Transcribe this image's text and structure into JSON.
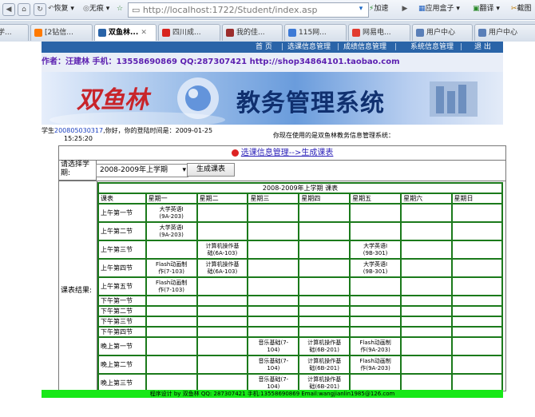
{
  "browser": {
    "back_label": "恢复",
    "noimg_label": "无痕",
    "url": "http://localhost:1722/Student/index.asp",
    "accelerate_label": "加速",
    "app_box_label": "应用盒子",
    "translate_label": "翻译",
    "screenshot_label": "截图",
    "tabs": [
      "学...",
      "[2钻信...",
      "双鱼林...",
      "四川成...",
      "我的佳...",
      "115网...",
      "网易电...",
      "用户中心",
      "用户中心"
    ]
  },
  "site": {
    "nav": [
      "首 页",
      "选课信息管理",
      "成绩信息管理",
      "系统信息管理",
      "退 出"
    ],
    "author": "作者：汪建林  手机：13558690869 QQ:287307421 http://shop34864101.taobao.com",
    "banner_left": "双鱼林",
    "banner_right": "教务管理系统",
    "student_prefix": "学生",
    "student_id": "200805030317",
    "login_text": ",你好，你的登陆时间是：2009-01-25",
    "login_time": "15:25:20",
    "using_text": "你现在使用的是双鱼林教务信息管理系统：",
    "breadcrumb": "选课信息管理-->生成课表",
    "term_label": "请选择学期:",
    "term_value": "2008-2009年上学期",
    "generate_button": "生成课表",
    "result_label": "课表结果:",
    "footer": "程序设计 by 双鱼林  QQ: 287307421 手机:13558690869 Email:wangjianlin1985@126.com"
  },
  "timetable": {
    "title": "2008-2009年上学期 课表",
    "headers": [
      "课表",
      "星期一",
      "星期二",
      "星期三",
      "星期四",
      "星期五",
      "星期六",
      "星期日"
    ],
    "rows": [
      {
        "period": "上午第一节",
        "cells": [
          "大学英语I\n(9A-203)",
          "",
          "",
          "",
          "",
          "",
          ""
        ]
      },
      {
        "period": "上午第二节",
        "cells": [
          "大学英语I\n(9A-203)",
          "",
          "",
          "",
          "",
          "",
          ""
        ]
      },
      {
        "period": "上午第三节",
        "cells": [
          "",
          "计算机操作基\n础(6A-103)",
          "",
          "",
          "大学英语I\n(9B-301)",
          "",
          ""
        ]
      },
      {
        "period": "上午第四节",
        "cells": [
          "Flash动画制\n作(7-103)",
          "计算机操作基\n础(6A-103)",
          "",
          "",
          "大学英语I\n(9B-301)",
          "",
          ""
        ]
      },
      {
        "period": "上午第五节",
        "cells": [
          "Flash动画制\n作(7-103)",
          "",
          "",
          "",
          "",
          "",
          ""
        ]
      },
      {
        "period": "下午第一节",
        "cells": [
          "",
          "",
          "",
          "",
          "",
          "",
          ""
        ]
      },
      {
        "period": "下午第二节",
        "cells": [
          "",
          "",
          "",
          "",
          "",
          "",
          ""
        ]
      },
      {
        "period": "下午第三节",
        "cells": [
          "",
          "",
          "",
          "",
          "",
          "",
          ""
        ]
      },
      {
        "period": "下午第四节",
        "cells": [
          "",
          "",
          "",
          "",
          "",
          "",
          ""
        ]
      },
      {
        "period": "晚上第一节",
        "cells": [
          "",
          "",
          "音乐基础(7-\n104)",
          "计算机操作基\n础(6B-201)",
          "Flash动画制\n作(9A-203)",
          "",
          ""
        ]
      },
      {
        "period": "晚上第二节",
        "cells": [
          "",
          "",
          "音乐基础(7-\n104)",
          "计算机操作基\n础(6B-201)",
          "Flash动画制\n作(9A-203)",
          "",
          ""
        ]
      },
      {
        "period": "晚上第三节",
        "cells": [
          "",
          "",
          "音乐基础(7-\n104)",
          "计算机操作基\n础(6B-201)",
          "",
          "",
          ""
        ]
      }
    ]
  }
}
